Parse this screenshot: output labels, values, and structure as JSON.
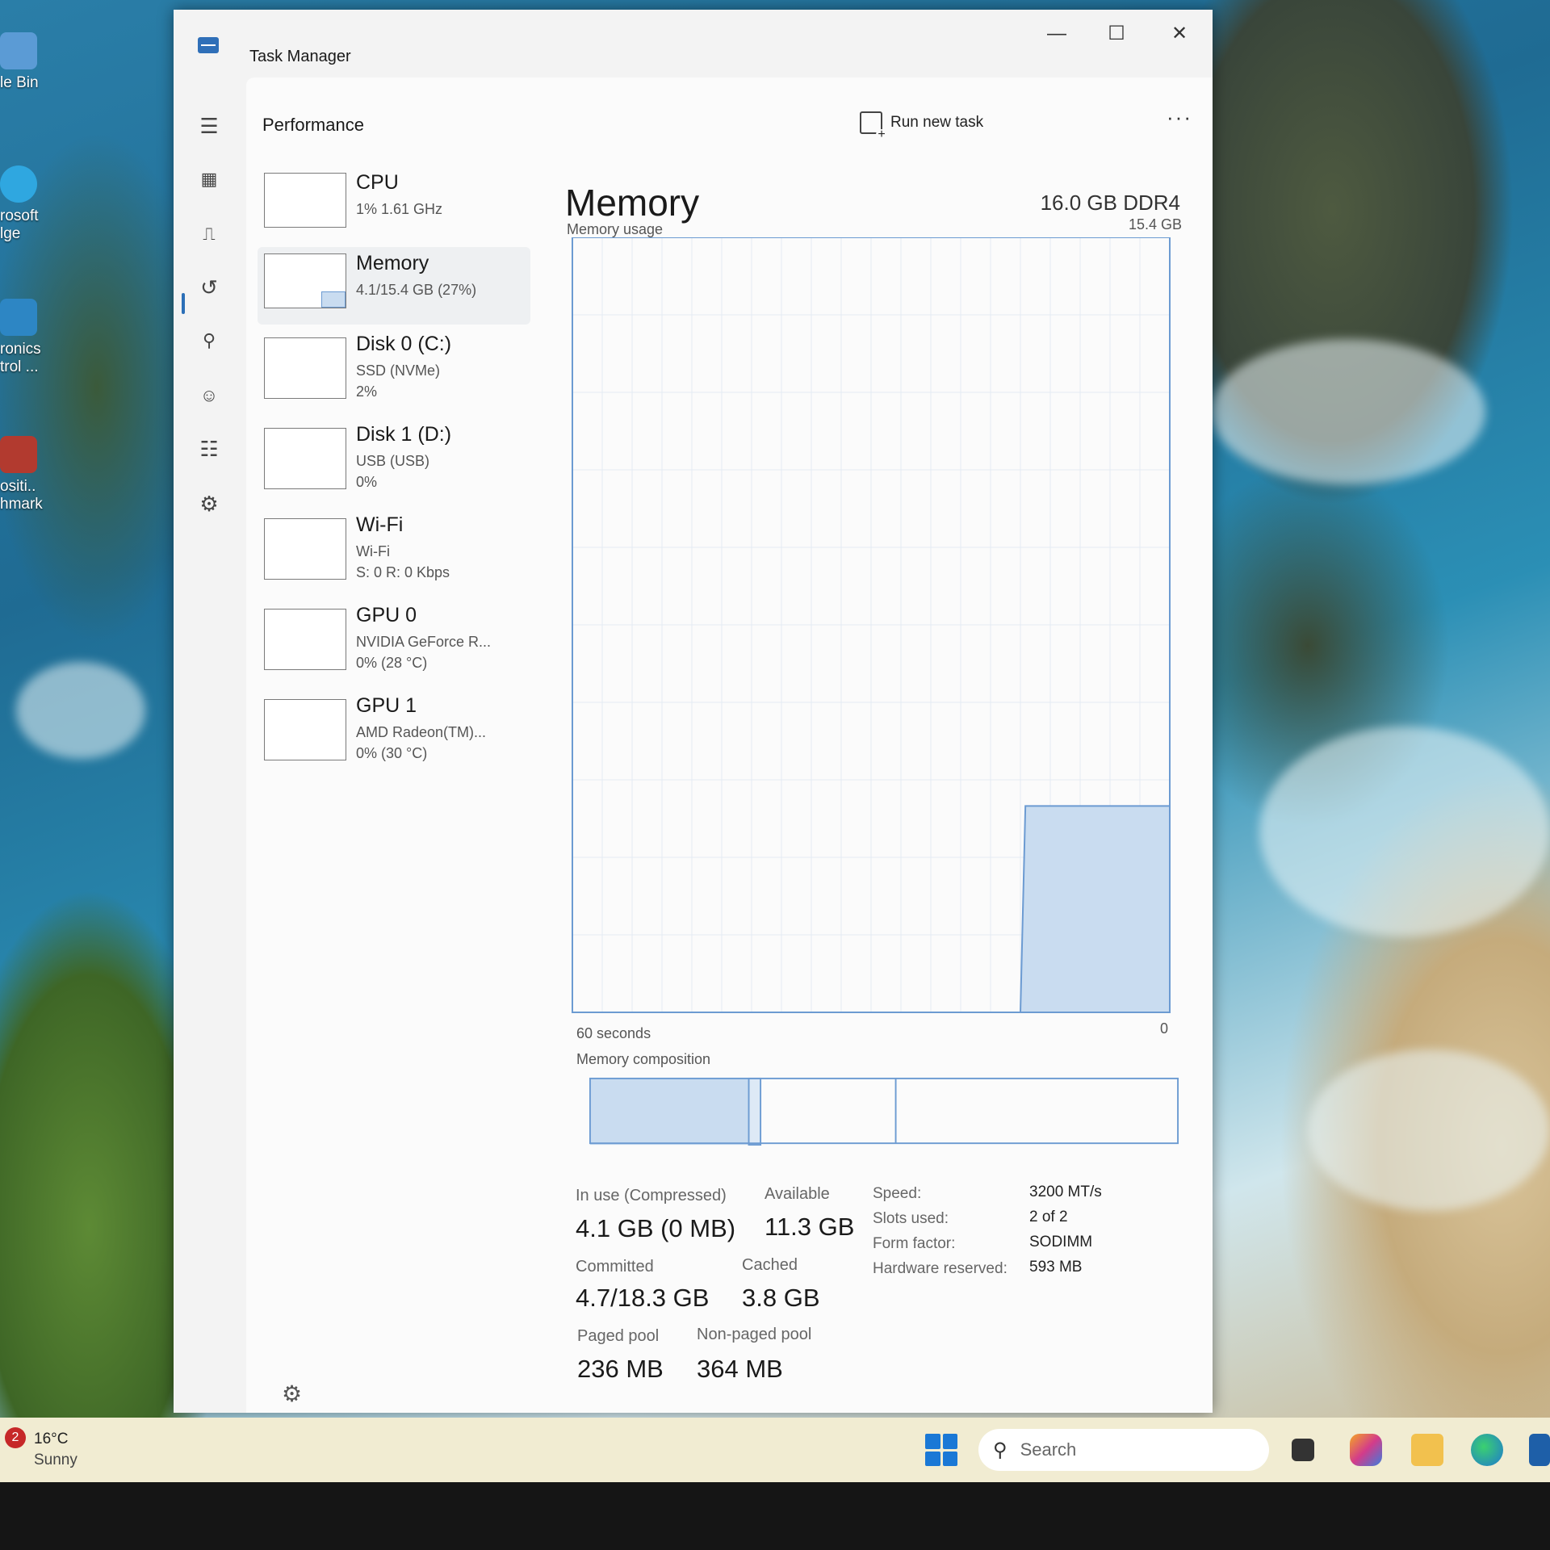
{
  "desktop": {
    "icons": [
      {
        "label": "le Bin"
      },
      {
        "label": "rosoft\nlge"
      },
      {
        "label": "ronics\ntrol ..."
      },
      {
        "label": "ositi..\nhmark"
      }
    ]
  },
  "window": {
    "title": "Task Manager",
    "controls": {
      "minimize": "—",
      "maximize": "☐",
      "close": "✕"
    }
  },
  "header": {
    "page_title": "Performance",
    "run_new_task": "Run new task",
    "more": "···"
  },
  "devices": [
    {
      "name": "CPU",
      "sub": [
        "1% 1.61 GHz"
      ]
    },
    {
      "name": "Memory",
      "sub": [
        "4.1/15.4 GB (27%)"
      ]
    },
    {
      "name": "Disk 0 (C:)",
      "sub": [
        "SSD (NVMe)",
        "2%"
      ]
    },
    {
      "name": "Disk 1 (D:)",
      "sub": [
        "USB (USB)",
        "0%"
      ]
    },
    {
      "name": "Wi-Fi",
      "sub": [
        "Wi-Fi",
        "S: 0 R: 0 Kbps"
      ]
    },
    {
      "name": "GPU 0",
      "sub": [
        "NVIDIA GeForce R...",
        "0% (28 °C)"
      ]
    },
    {
      "name": "GPU 1",
      "sub": [
        "AMD Radeon(TM)...",
        "0% (30 °C)"
      ]
    }
  ],
  "memory": {
    "title": "Memory",
    "capacity": "16.0 GB DDR4",
    "usage_label": "Memory usage",
    "usage_max": "15.4 GB",
    "time_label": "60 seconds",
    "time_end": "0",
    "composition_label": "Memory composition",
    "stats": {
      "in_use_label": "In use (Compressed)",
      "in_use_value": "4.1 GB (0 MB)",
      "available_label": "Available",
      "available_value": "11.3 GB",
      "committed_label": "Committed",
      "committed_value": "4.7/18.3 GB",
      "cached_label": "Cached",
      "cached_value": "3.8 GB",
      "paged_label": "Paged pool",
      "paged_value": "236 MB",
      "nonpaged_label": "Non-paged pool",
      "nonpaged_value": "364 MB"
    },
    "specs": [
      {
        "key": "Speed:",
        "value": "3200 MT/s"
      },
      {
        "key": "Slots used:",
        "value": "2 of 2"
      },
      {
        "key": "Form factor:",
        "value": "SODIMM"
      },
      {
        "key": "Hardware reserved:",
        "value": "593 MB"
      }
    ]
  },
  "chart_data": {
    "type": "area",
    "title": "Memory usage",
    "xlabel": "",
    "ylabel": "",
    "x_range_seconds": [
      60,
      0
    ],
    "ylim_gb": [
      0,
      15.4
    ],
    "x": [
      60,
      15,
      14.5,
      0
    ],
    "values": [
      0,
      0,
      4.1,
      4.1
    ],
    "grid": true
  },
  "composition": {
    "in_use_fraction": 0.27,
    "modified_fraction": 0.02,
    "standby_fraction": 0.23,
    "free_fraction": 0.48
  },
  "taskbar": {
    "weather_badge": "2",
    "temperature": "16°C",
    "condition": "Sunny",
    "search_placeholder": "Search"
  },
  "colors": {
    "accent": "#2b6fb7",
    "chart_fill": "#c9dcf0",
    "chart_line": "#6c9bd2",
    "grid": "#e4ebf3"
  }
}
